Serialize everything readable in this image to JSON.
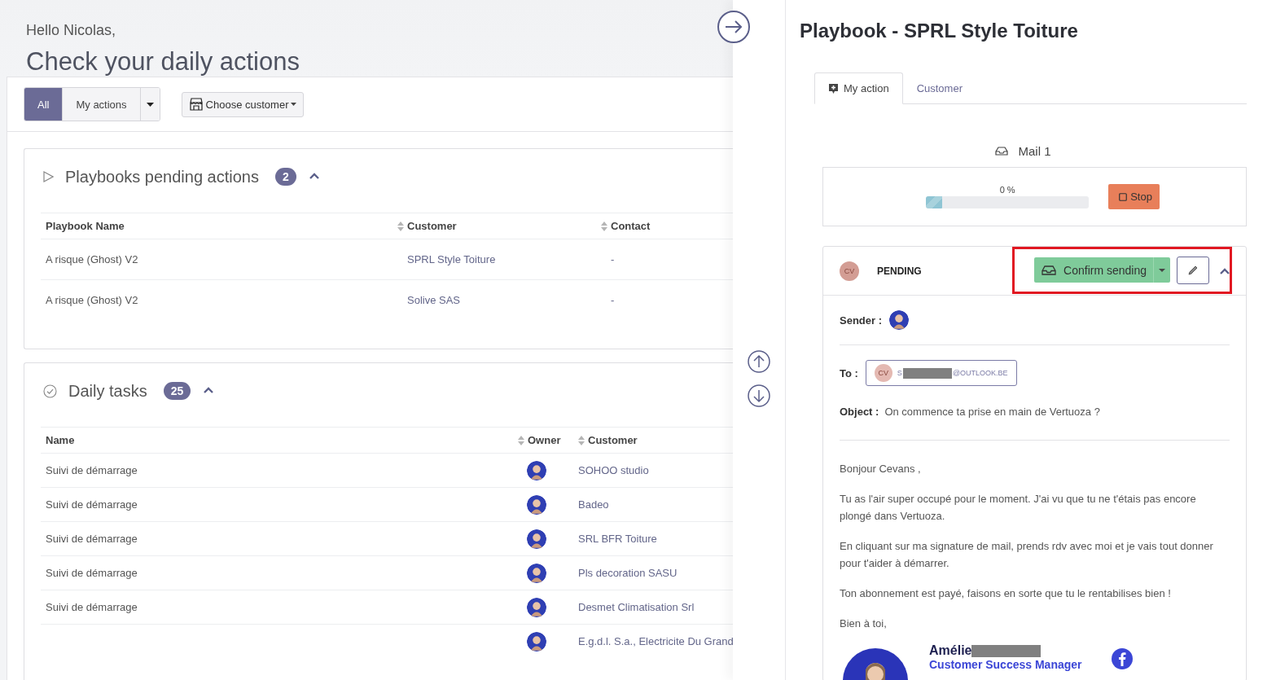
{
  "greeting": "Hello Nicolas,",
  "heading": "Check your daily actions",
  "filters": {
    "segments": [
      {
        "label": "All",
        "selected": true
      },
      {
        "label": "My actions",
        "selected": false
      }
    ],
    "customer_select": "Choose customer"
  },
  "sections": [
    {
      "kind": "playbooks",
      "title": "Playbooks pending actions",
      "count": "2",
      "expanded": true,
      "columns": [
        {
          "label": "Playbook Name",
          "kind": "text",
          "sortable": false
        },
        {
          "label": "Customer",
          "kind": "text",
          "sortable": true
        },
        {
          "label": "Contact",
          "kind": "text",
          "sortable": true
        }
      ],
      "rows": [
        {
          "cells": [
            "A risque (Ghost) V2",
            "SPRL Style Toiture",
            "-"
          ]
        },
        {
          "cells": [
            "A risque (Ghost) V2",
            "Solive SAS",
            "-"
          ]
        }
      ]
    },
    {
      "kind": "tasks",
      "title": "Daily tasks",
      "count": "25",
      "expanded": true,
      "columns": [
        {
          "label": "Name",
          "kind": "text",
          "sortable": false
        },
        {
          "label": "Owner",
          "kind": "avatar",
          "sortable": true
        },
        {
          "label": "Customer",
          "kind": "text",
          "sortable": true
        }
      ],
      "rows": [
        {
          "cells": [
            "Suivi de démarrage",
            "SOHOO studio"
          ]
        },
        {
          "cells": [
            "Suivi de démarrage",
            "Badeo"
          ]
        },
        {
          "cells": [
            "Suivi de démarrage",
            "SRL BFR Toiture"
          ]
        },
        {
          "cells": [
            "Suivi de démarrage",
            "Pls decoration SASU"
          ]
        },
        {
          "cells": [
            "Suivi de démarrage",
            "Desmet Climatisation Srl"
          ]
        },
        {
          "cells": [
            "",
            "E.g.d.l. S.a., Electricite Du Grand"
          ]
        }
      ]
    }
  ],
  "drawer": {
    "title": "Playbook - SPRL Style Toiture",
    "tabs": [
      {
        "label": "My action",
        "selected": true
      },
      {
        "label": "Customer",
        "selected": false
      }
    ],
    "step": {
      "title": "Mail 1",
      "reading": "0 %",
      "level": 0.1,
      "stop_label": "Stop"
    },
    "message": {
      "initials": "CV",
      "status": "PENDING",
      "confirm_label": "Confirm sending",
      "highlighted": true,
      "expanded": true,
      "sender_label": "Sender :",
      "to_label": "To :",
      "recipient": {
        "initials": "CV",
        "email_start": "S",
        "email_end": "@OUTLOOK.BE"
      },
      "object_label": "Object :",
      "object": "On commence ta prise en main de Vertuoza ?",
      "body": [
        "Bonjour Cevans ,",
        "Tu as l'air super occupé pour le moment. J'ai vu que tu ne t'étais pas encore plongé dans Vertuoza.",
        "En cliquant sur ma signature de mail, prends rdv avec moi et je vais tout donner pour t'aider à démarrer.",
        "Ton abonnement est payé, faisons en sorte que tu le rentabilises bien !",
        "Bien à toi,"
      ],
      "signature": {
        "name": "Amélie",
        "role": "Customer Success Manager"
      }
    }
  }
}
